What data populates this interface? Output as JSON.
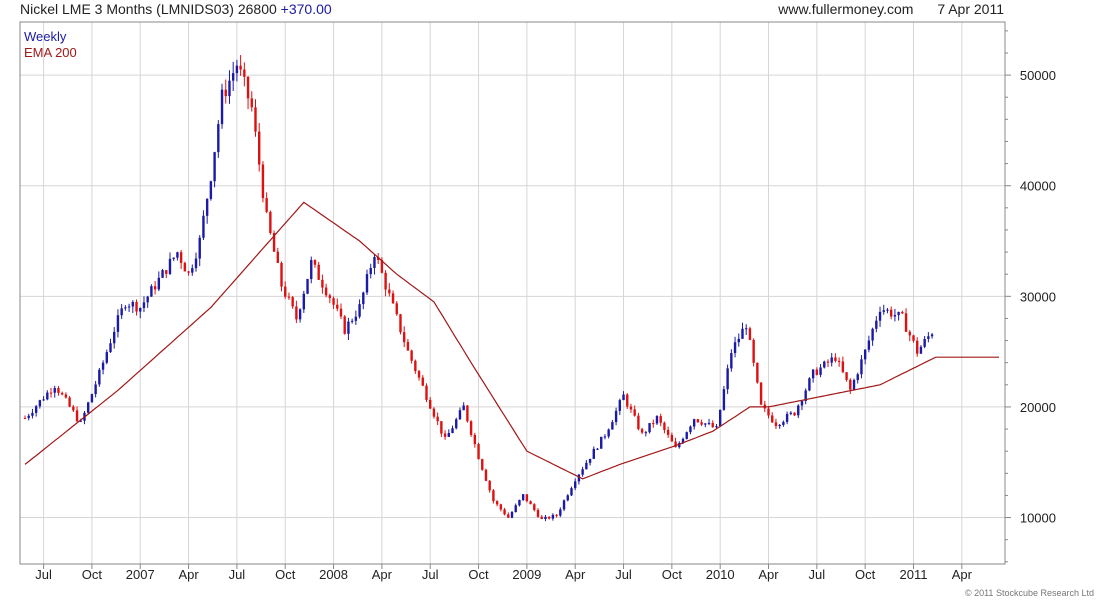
{
  "header": {
    "title": "Nickel LME 3 Months (LMNIDS03) 26800",
    "change": "+370.00",
    "site": "www.fullermoney.com",
    "date": "7 Apr 2011"
  },
  "legend": {
    "series_label": "Weekly",
    "ema_label": "EMA 200"
  },
  "copyright": "© 2011 Stockcube Research Ltd",
  "colors": {
    "up": "#1a1aa6",
    "down": "#dd1111",
    "ema": "#a11818",
    "grid": "#d6d6d6",
    "frame": "#888888"
  },
  "chart_data": {
    "type": "candlestick",
    "title": "Nickel LME 3 Months (LMNIDS03) 26800",
    "ylim": [
      5800,
      54800
    ],
    "yticks": [
      10000,
      20000,
      30000,
      40000,
      50000
    ],
    "ytick_labels": [
      "10000",
      "20000",
      "30000",
      "40000",
      "50000"
    ],
    "x_axis_labels": [
      "Jul",
      "Oct",
      "2007",
      "Apr",
      "Jul",
      "Oct",
      "2008",
      "Apr",
      "Jul",
      "Oct",
      "2009",
      "Apr",
      "Jul",
      "Oct",
      "2010",
      "Apr",
      "Jul",
      "Oct",
      "2011",
      "Apr"
    ],
    "series_labels": [
      "Weekly",
      "EMA 200"
    ],
    "price_anchors_weeks": [
      0,
      8,
      15,
      20,
      24,
      27,
      31,
      35,
      39,
      41,
      44,
      47,
      50,
      53,
      57,
      61,
      65,
      69,
      73,
      77,
      82,
      86,
      90,
      94,
      98,
      103,
      108,
      113,
      118,
      122,
      126,
      130,
      134,
      139,
      143,
      148,
      152,
      156,
      161,
      166,
      170,
      175,
      180,
      186,
      190,
      194,
      198,
      202,
      207,
      212,
      218,
      222,
      226,
      230,
      236,
      240,
      244,
      248,
      252,
      256,
      262
    ],
    "price_anchor_values": [
      19000,
      22000,
      18500,
      23000,
      27000,
      29500,
      29000,
      31000,
      33000,
      34000,
      32000,
      35000,
      41000,
      48000,
      51000,
      47000,
      37000,
      31000,
      28000,
      33000,
      30000,
      27000,
      29000,
      34000,
      30000,
      25000,
      21000,
      17000,
      20000,
      15500,
      11500,
      10000,
      12000,
      9800,
      10200,
      13500,
      15500,
      17500,
      21000,
      17500,
      19000,
      16200,
      19000,
      18000,
      25000,
      27500,
      20000,
      18500,
      19500,
      23000,
      24500,
      21500,
      25000,
      29000,
      28000,
      25000,
      26800
    ],
    "ema_anchors_weeks": [
      0,
      25,
      50,
      75,
      90,
      100,
      110,
      120,
      135,
      150,
      160,
      175,
      185,
      195,
      200,
      215,
      230,
      245,
      262
    ],
    "ema_anchor_values": [
      14800,
      21500,
      29000,
      38500,
      35000,
      32000,
      29500,
      24000,
      16000,
      13500,
      14800,
      16500,
      17800,
      20000,
      20000,
      21000,
      22000,
      24500,
      24500
    ]
  }
}
